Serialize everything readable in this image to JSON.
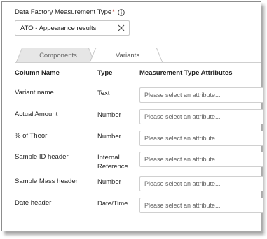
{
  "form": {
    "label": "Data Factory Measurement Type",
    "required_marker": "*",
    "selected_value": "ATO - Appearance results"
  },
  "tabs": [
    {
      "label": "Components",
      "active": false
    },
    {
      "label": "Variants",
      "active": true
    }
  ],
  "table": {
    "columns": [
      "Column Name",
      "Type",
      "Measurement Type Attributes"
    ],
    "rows": [
      {
        "name": "Variant name",
        "type_line1": "Text",
        "type_line2": "",
        "placeholder": "Please select an attribute..."
      },
      {
        "name": "Actual Amount",
        "type_line1": "Number",
        "type_line2": "",
        "placeholder": "Please select an attribute..."
      },
      {
        "name": "% of Theor",
        "type_line1": "Number",
        "type_line2": "",
        "placeholder": "Please select an attribute..."
      },
      {
        "name": "Sample ID header",
        "type_line1": "Internal",
        "type_line2": "Reference",
        "placeholder": "Please select an attribute..."
      },
      {
        "name": "Sample Mass header",
        "type_line1": "Number",
        "type_line2": "",
        "placeholder": "Please select an attribute..."
      },
      {
        "name": "Date header",
        "type_line1": "Date/Time",
        "type_line2": "",
        "placeholder": "Please select an attribute..."
      }
    ]
  },
  "icons": {
    "info": "info-circle-icon",
    "clear": "close-icon"
  }
}
